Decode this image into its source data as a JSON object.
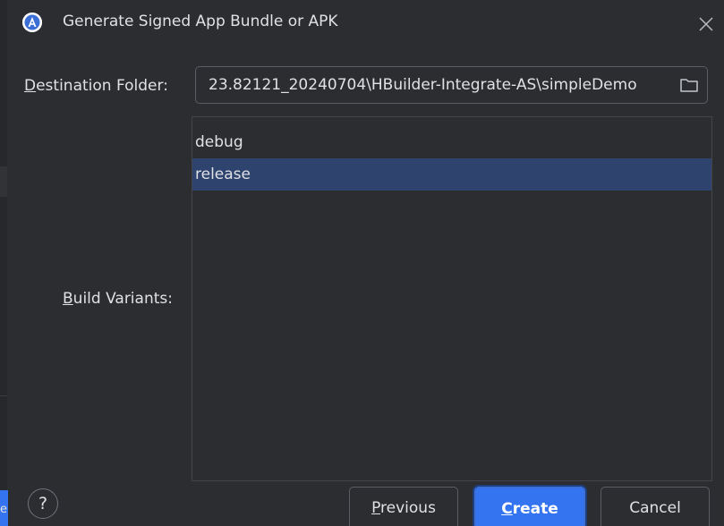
{
  "dialog": {
    "title": "Generate Signed App Bundle or APK",
    "logo_icon": "android-studio-icon",
    "close_icon": "close-icon"
  },
  "destination": {
    "label_mnemonic": "D",
    "label_rest": "estination Folder:",
    "value": "23.82121_20240704\\HBuilder-Integrate-AS\\simpleDemo",
    "browse_icon": "folder-icon"
  },
  "build_variants": {
    "label_mnemonic": "B",
    "label_rest": "uild Variants:",
    "items": [
      {
        "label": "debug",
        "selected": false
      },
      {
        "label": "release",
        "selected": true
      }
    ]
  },
  "footer": {
    "help_label": "?",
    "previous_mnemonic": "P",
    "previous_rest": "revious",
    "create_mnemonic": "C",
    "create_rest": "reate",
    "cancel_label": "Cancel"
  },
  "background_app": {
    "partial_text": "e"
  },
  "colors": {
    "dialog_bg": "#2b2d30",
    "selection": "#2e436e",
    "primary_button": "#3574f0",
    "text": "#dfe1e5"
  }
}
